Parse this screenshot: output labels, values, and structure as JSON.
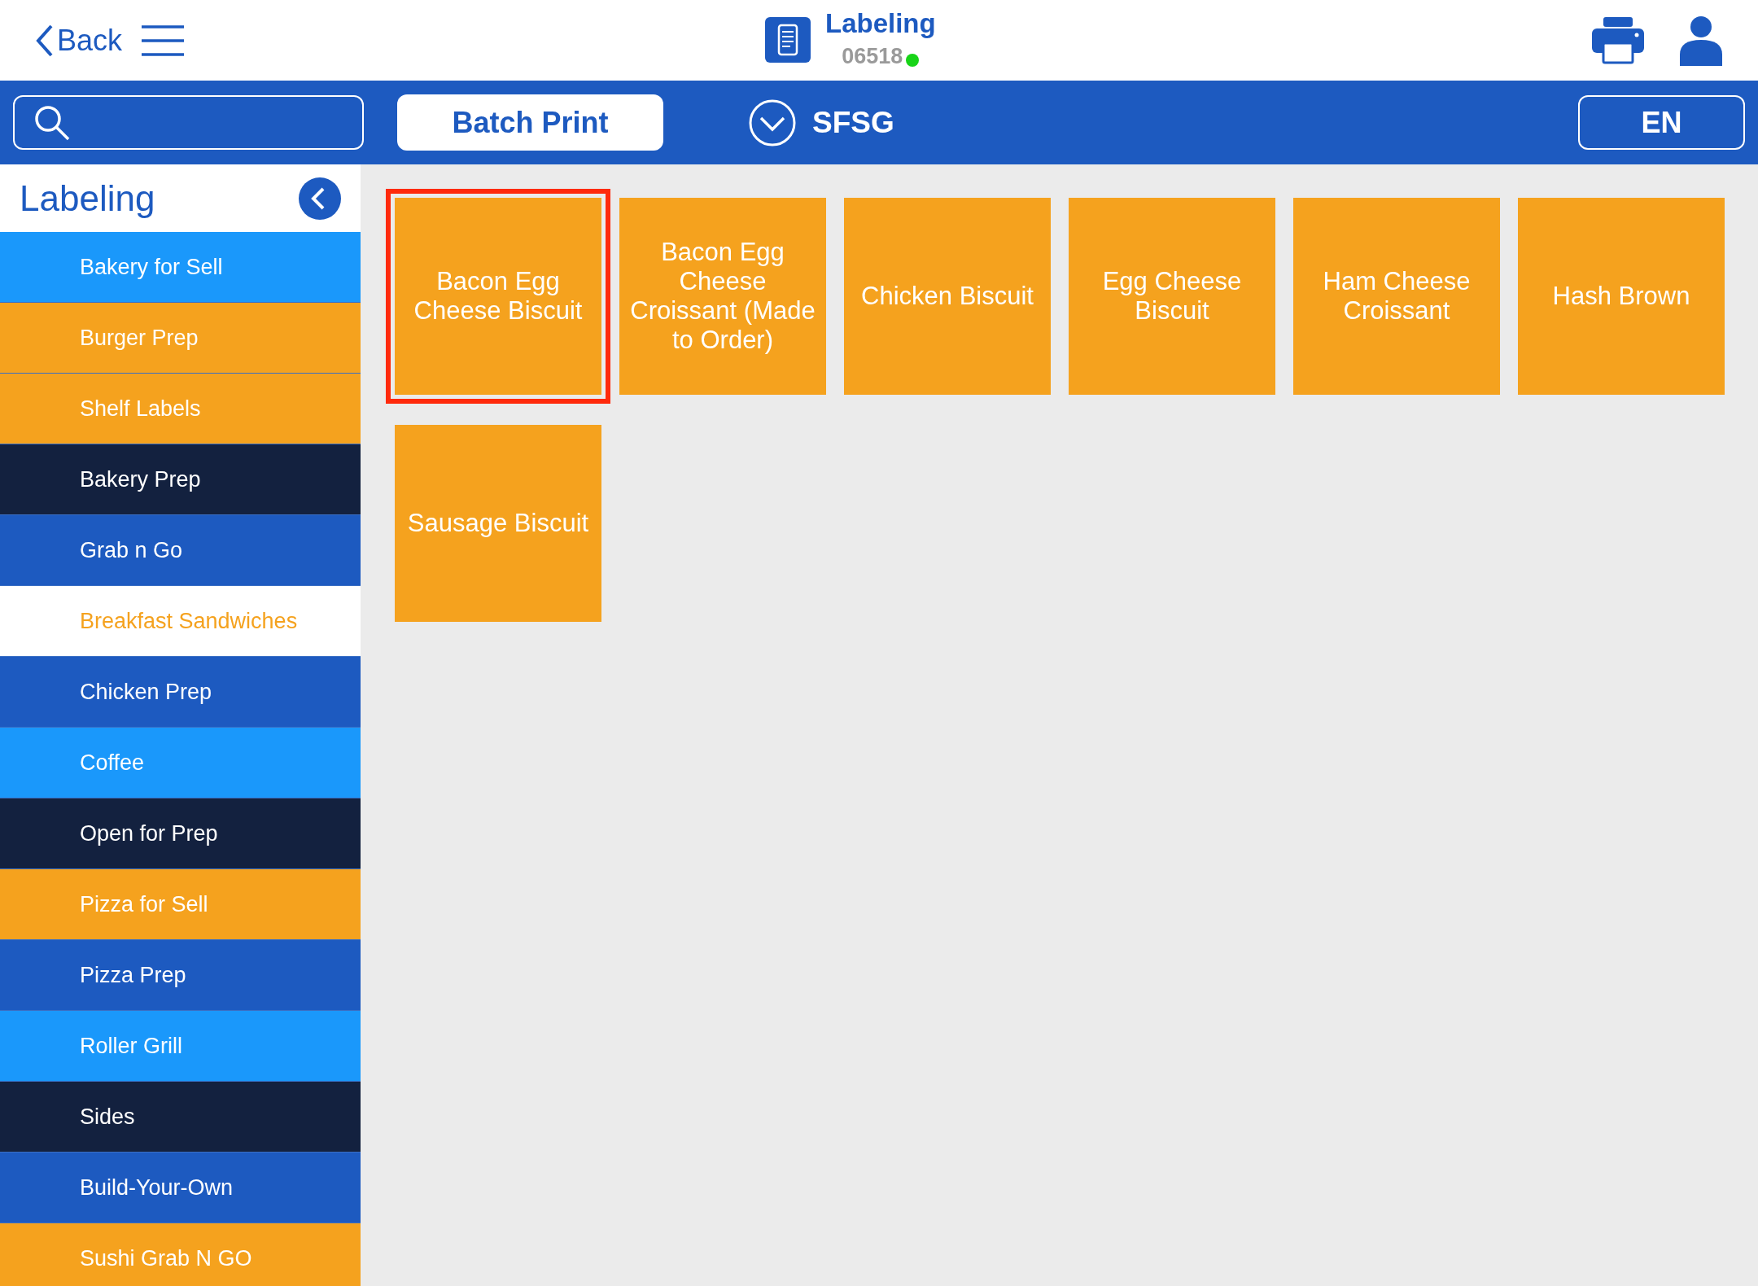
{
  "header": {
    "back": "Back",
    "title": "Labeling",
    "store_number": "06518",
    "online": true
  },
  "toolbar": {
    "batch_print": "Batch Print",
    "store_group": "SFSG",
    "language": "EN"
  },
  "sidebar": {
    "title": "Labeling",
    "items": [
      {
        "label": "Bakery for Sell",
        "color": "#1a98fb",
        "selected": false
      },
      {
        "label": "Burger Prep",
        "color": "#f5a21e",
        "selected": false
      },
      {
        "label": "Shelf Labels",
        "color": "#f5a21e",
        "selected": false
      },
      {
        "label": "Bakery Prep",
        "color": "#13213f",
        "selected": false
      },
      {
        "label": "Grab n Go",
        "color": "#1d5ac0",
        "selected": false
      },
      {
        "label": "Breakfast Sandwiches",
        "color": "#f5a21e",
        "selected": true
      },
      {
        "label": "Chicken Prep",
        "color": "#1d5ac0",
        "selected": false
      },
      {
        "label": "Coffee",
        "color": "#1a98fb",
        "selected": false
      },
      {
        "label": "Open for Prep",
        "color": "#13213f",
        "selected": false
      },
      {
        "label": "Pizza for Sell",
        "color": "#f5a21e",
        "selected": false
      },
      {
        "label": "Pizza Prep",
        "color": "#1d5ac0",
        "selected": false
      },
      {
        "label": "Roller Grill",
        "color": "#1a98fb",
        "selected": false
      },
      {
        "label": "Sides",
        "color": "#13213f",
        "selected": false
      },
      {
        "label": "Build-Your-Own",
        "color": "#1d5ac0",
        "selected": false
      },
      {
        "label": "Sushi Grab N GO",
        "color": "#f5a21e",
        "selected": false
      }
    ]
  },
  "products": [
    {
      "label": "Bacon Egg Cheese Biscuit",
      "selected": true
    },
    {
      "label": "Bacon Egg Cheese Croissant (Made to Order)",
      "selected": false
    },
    {
      "label": "Chicken Biscuit",
      "selected": false
    },
    {
      "label": "Egg Cheese Biscuit",
      "selected": false
    },
    {
      "label": "Ham Cheese Croissant",
      "selected": false
    },
    {
      "label": "Hash Brown",
      "selected": false
    },
    {
      "label": "Sausage Biscuit",
      "selected": false
    }
  ]
}
